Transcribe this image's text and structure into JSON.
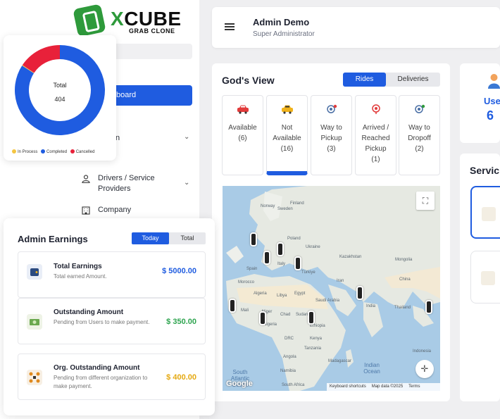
{
  "logo": {
    "title_x": "X",
    "title_rest": "CUBE",
    "subtitle": "GRAB CLONE"
  },
  "sidebar": {
    "active_label": "board",
    "items": [
      {
        "label": "n"
      },
      {
        "label": "Drivers / Service Providers"
      },
      {
        "label": "Company"
      }
    ]
  },
  "header": {
    "title": "Admin Demo",
    "subtitle": "Super Administrator"
  },
  "gods_view": {
    "title": "God's View",
    "tabs": [
      "Rides",
      "Deliveries"
    ],
    "statuses": [
      {
        "label": "Available",
        "count": "(6)",
        "icon": "car-red-icon"
      },
      {
        "label": "Not Available",
        "count": "(16)",
        "icon": "car-yellow-icon"
      },
      {
        "label": "Way to Pickup",
        "count": "(3)",
        "icon": "pickup-pin-icon"
      },
      {
        "label": "Arrived / Reached Pickup",
        "count": "(1)",
        "icon": "arrived-pin-icon"
      },
      {
        "label": "Way to Dropoff",
        "count": "(2)",
        "icon": "dropoff-pin-icon"
      }
    ]
  },
  "map": {
    "labels": [
      "Norway",
      "Sweden",
      "Finland",
      "Kazakhstan",
      "Mongolia",
      "Spain",
      "Italy",
      "Türkiye",
      "Iran",
      "China",
      "Algeria",
      "Libya",
      "Egypt",
      "Saudi Arabia",
      "India",
      "Thailand",
      "Mali",
      "Niger",
      "Chad",
      "Sudan",
      "Ethiopia",
      "Nigeria",
      "DRC",
      "Kenya",
      "Tanzania",
      "Angola",
      "Namibia",
      "South Africa",
      "Poland",
      "Ukraine",
      "Morocco",
      "Indonesia",
      "Madagascar"
    ],
    "seas": [
      "South Atlantic Ocean",
      "Indian Ocean"
    ],
    "brand": "Google",
    "footer": [
      "Keyboard shortcuts",
      "Map data ©2025",
      "Terms"
    ]
  },
  "right_cards": {
    "users_label": "Use",
    "users_value": "6",
    "services_title": "Servic"
  },
  "ride_chart": {
    "center_label": "Total",
    "center_value": "404",
    "legend": [
      {
        "name": "In Process",
        "color": "#f4c542"
      },
      {
        "name": "Completed",
        "color": "#1f5ce0"
      },
      {
        "name": "Cancelled",
        "color": "#e8213a"
      }
    ]
  },
  "earnings": {
    "title": "Admin Earnings",
    "tabs": [
      "Today",
      "Total"
    ],
    "rows": [
      {
        "title": "Total Earnings",
        "subtitle": "Total earned Amount.",
        "value": "$ 5000.00",
        "color": "#1f5ce0",
        "icon": "wallet-icon"
      },
      {
        "title": "Outstanding Amount",
        "subtitle": "Pending from Users to make payment.",
        "value": "$ 350.00",
        "color": "#2ea44f",
        "icon": "money-icon"
      },
      {
        "title": "Org. Outstanding Amount",
        "subtitle": "Pending from different organization to make payment.",
        "value": "$ 400.00",
        "color": "#e5a911",
        "icon": "organization-icon"
      }
    ]
  },
  "chart_data": {
    "type": "pie",
    "categories": [
      "In Process",
      "Completed",
      "Cancelled"
    ],
    "values": [
      1,
      340,
      63
    ],
    "colors": [
      "#f4c542",
      "#1f5ce0",
      "#e8213a"
    ],
    "title": "",
    "center_text": [
      "Total",
      "404"
    ],
    "legend_placement": "bottom"
  }
}
